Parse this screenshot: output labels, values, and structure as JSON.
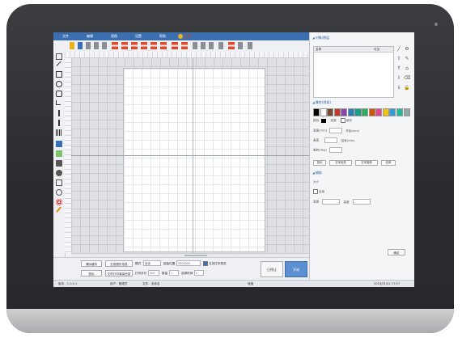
{
  "menu": [
    "文件",
    "编辑",
    "视图",
    "设置",
    "帮助"
  ],
  "menu_extra": "主题",
  "canvas_bottom_controls": {
    "row1": {
      "btn_a": "清除缓存",
      "btn_b": "生成图形信息",
      "mode_label": "模式",
      "mode_value": "普通",
      "pos_label": "起始位置",
      "pos_value": "0000000",
      "check_label": "支持打印预览"
    },
    "row2": {
      "btn_a": "退出",
      "btn_b": "文件打印渲染信息",
      "step_label": "打印步长",
      "step_value": "500",
      "count_label": "数量",
      "count_value": "1",
      "unit_label": "选择时间",
      "unit_value": "s"
    },
    "btn_stop": "已停止",
    "btn_start": "开始"
  },
  "status_bar": {
    "left": "版本：1.0.0.1",
    "mid1": "用户：管理员",
    "mid2": "文件：未命名",
    "mid3": "就绪",
    "right": "2023/01/01 17:57"
  },
  "right_panel": {
    "layers_title": "对象/图层",
    "layers_cols": [
      "名称",
      "可见"
    ],
    "props_title": "属性(线条)",
    "color_label": "颜色",
    "width_label": "线宽",
    "row1_l": "宽度(mm)",
    "row1_r": "开始(mm)",
    "row2_l": "高度",
    "row2_r": "结束(mm)",
    "row3_l": "旋转(deg)",
    "fill_check": "填充",
    "btn1": "变化",
    "btn2": "文本检查",
    "btn3": "文本旋转",
    "btn4": "应用",
    "sec_title": "辅助",
    "sec_row1": "大小",
    "sec_check": "启用",
    "sec_row2_l": "宽度",
    "sec_row2_r": "高度",
    "ok_btn": "确定"
  },
  "colors": {
    "accent": "#3b6fb0",
    "palette": [
      "#000000",
      "#ffffff",
      "#7a4b2e",
      "#c0392b",
      "#8e44ad",
      "#2980b9",
      "#16a085",
      "#27ae60",
      "#d35400",
      "#e84393",
      "#f1c40f",
      "#3498db",
      "#1abc9c",
      "#95a5a6"
    ]
  }
}
